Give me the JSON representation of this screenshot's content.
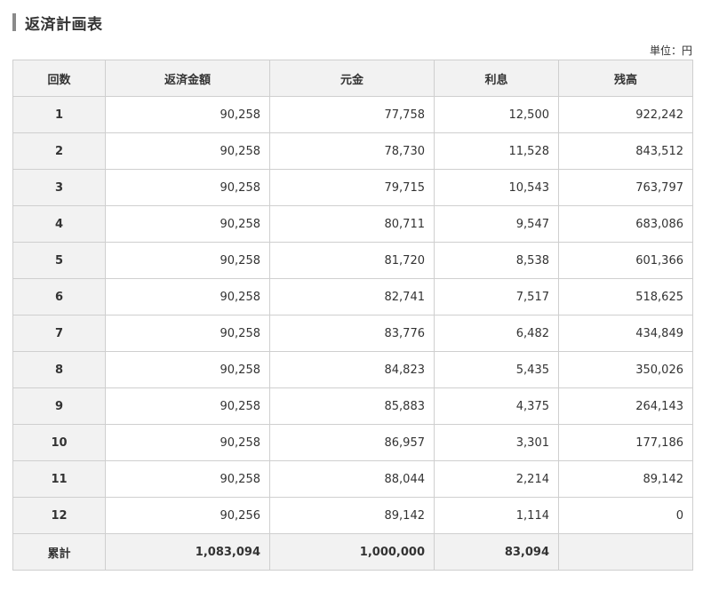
{
  "title": "返済計画表",
  "unit_label": "単位：円",
  "table": {
    "headers": [
      "回数",
      "返済金額",
      "元金",
      "利息",
      "残高"
    ],
    "rows": [
      {
        "no": "1",
        "payment": "90,258",
        "principal": "77,758",
        "interest": "12,500",
        "balance": "922,242"
      },
      {
        "no": "2",
        "payment": "90,258",
        "principal": "78,730",
        "interest": "11,528",
        "balance": "843,512"
      },
      {
        "no": "3",
        "payment": "90,258",
        "principal": "79,715",
        "interest": "10,543",
        "balance": "763,797"
      },
      {
        "no": "4",
        "payment": "90,258",
        "principal": "80,711",
        "interest": "9,547",
        "balance": "683,086"
      },
      {
        "no": "5",
        "payment": "90,258",
        "principal": "81,720",
        "interest": "8,538",
        "balance": "601,366"
      },
      {
        "no": "6",
        "payment": "90,258",
        "principal": "82,741",
        "interest": "7,517",
        "balance": "518,625"
      },
      {
        "no": "7",
        "payment": "90,258",
        "principal": "83,776",
        "interest": "6,482",
        "balance": "434,849"
      },
      {
        "no": "8",
        "payment": "90,258",
        "principal": "84,823",
        "interest": "5,435",
        "balance": "350,026"
      },
      {
        "no": "9",
        "payment": "90,258",
        "principal": "85,883",
        "interest": "4,375",
        "balance": "264,143"
      },
      {
        "no": "10",
        "payment": "90,258",
        "principal": "86,957",
        "interest": "3,301",
        "balance": "177,186"
      },
      {
        "no": "11",
        "payment": "90,258",
        "principal": "88,044",
        "interest": "2,214",
        "balance": "89,142"
      },
      {
        "no": "12",
        "payment": "90,256",
        "principal": "89,142",
        "interest": "1,114",
        "balance": "0"
      }
    ],
    "total": {
      "label": "累計",
      "payment": "1,083,094",
      "principal": "1,000,000",
      "interest": "83,094",
      "balance": ""
    }
  }
}
